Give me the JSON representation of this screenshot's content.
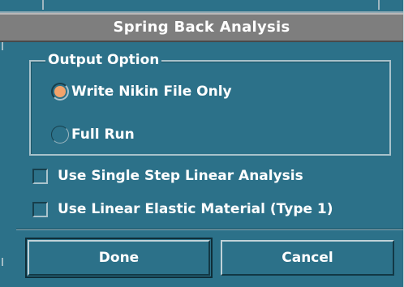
{
  "dialog": {
    "title": "Spring Back Analysis"
  },
  "output_option": {
    "legend": "Output Option",
    "options": [
      {
        "label": "Write Nikin File Only",
        "selected": true
      },
      {
        "label": "Full Run",
        "selected": false
      }
    ]
  },
  "checkboxes": [
    {
      "label": "Use Single Step Linear Analysis",
      "checked": false
    },
    {
      "label": "Use Linear Elastic Material (Type 1)",
      "checked": false
    }
  ],
  "buttons": {
    "done_label": "Done",
    "cancel_label": "Cancel"
  },
  "colors": {
    "background": "#2c7189",
    "titlebar": "#7e7e7e",
    "radio_selected": "#f3a36a",
    "text": "#ffffff"
  }
}
